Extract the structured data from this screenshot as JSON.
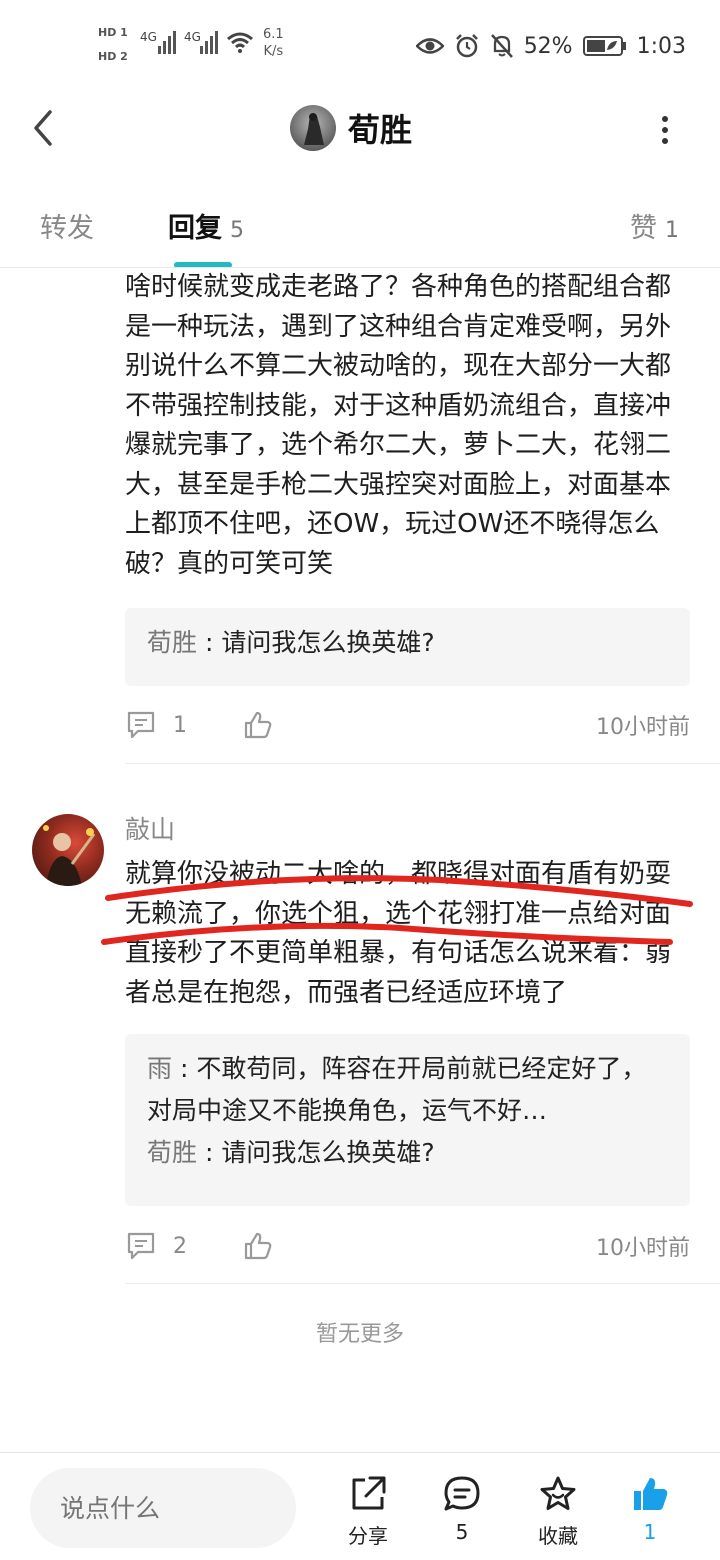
{
  "status_bar": {
    "hd1": "HD 1",
    "hd2": "HD 2",
    "sig1": "4G",
    "sig2": "4G",
    "speed_value": "6.1",
    "speed_unit": "K/s",
    "battery": "52%",
    "time": "1:03"
  },
  "header": {
    "title": "荀胜"
  },
  "tabs": {
    "forward": "转发",
    "reply": "回复",
    "reply_count": "5",
    "like": "赞",
    "like_count": "1"
  },
  "posts": [
    {
      "text": "啥时候就变成走老路了？各种角色的搭配组合都是一种玩法，遇到了这种组合肯定难受啊，另外别说什么不算二大被动啥的，现在大部分一大都不带强控制技能，对于这种盾奶流组合，直接冲爆就完事了，选个希尔二大，萝卜二大，花翎二大，甚至是手枪二大强控突对面脸上，对面基本上都顶不住吧，还OW，玩过OW还不晓得怎么破？真的可笑可笑",
      "quotes": [
        {
          "name": "荀胜",
          "sep": " : ",
          "text": "请问我怎么换英雄?"
        }
      ],
      "comment_count": "1",
      "time": "10小时前"
    },
    {
      "author": "敲山",
      "text": "就算你没被动二大啥的，都晓得对面有盾有奶耍无赖流了，你选个狙，选个花翎打准一点给对面直接秒了不更简单粗暴，有句话怎么说来着：弱者总是在抱怨，而强者已经适应环境了",
      "quotes": [
        {
          "name": "雨",
          "sep": " : ",
          "text": "不敢苟同，阵容在开局前就已经定好了，对局中途又不能换角色，运气不好…"
        },
        {
          "name": "荀胜",
          "sep": " : ",
          "text": "请问我怎么换英雄?"
        }
      ],
      "comment_count": "2",
      "time": "10小时前"
    }
  ],
  "no_more": "暂无更多",
  "bottom_bar": {
    "input_placeholder": "说点什么",
    "share": "分享",
    "comments": "5",
    "favorite": "收藏",
    "likes": "1"
  },
  "colors": {
    "accent": "#23b8c6",
    "annotation_red": "#e0261e",
    "like_blue": "#1aa0e8"
  }
}
